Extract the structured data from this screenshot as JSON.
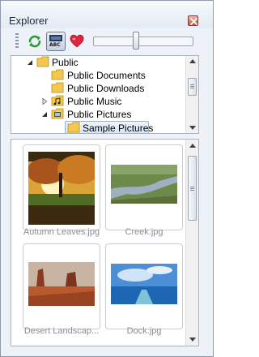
{
  "window": {
    "title": "Explorer"
  },
  "toolbar": {
    "refresh_icon": "refresh-icon",
    "abc_label": "ABC",
    "heart_icon": "heart-icon",
    "zoom_slider_level": 0.42
  },
  "tree": {
    "items": [
      {
        "label": "Public",
        "expanded": true
      },
      {
        "label": "Public Documents"
      },
      {
        "label": "Public Downloads"
      },
      {
        "label": "Public Music",
        "expanded": false
      },
      {
        "label": "Public Pictures",
        "expanded": true
      },
      {
        "label": "Sample Pictures",
        "selected": true
      }
    ]
  },
  "thumbnails": [
    {
      "caption": "Autumn Leaves.jpg"
    },
    {
      "caption": "Creek.jpg"
    },
    {
      "caption": "Desert Landscap..."
    },
    {
      "caption": "Dock.jpg"
    }
  ],
  "colors": {
    "selection_border": "#8fb3d8",
    "folder_yellow": "#f4c84c",
    "caption_gray": "#8a8f96"
  }
}
